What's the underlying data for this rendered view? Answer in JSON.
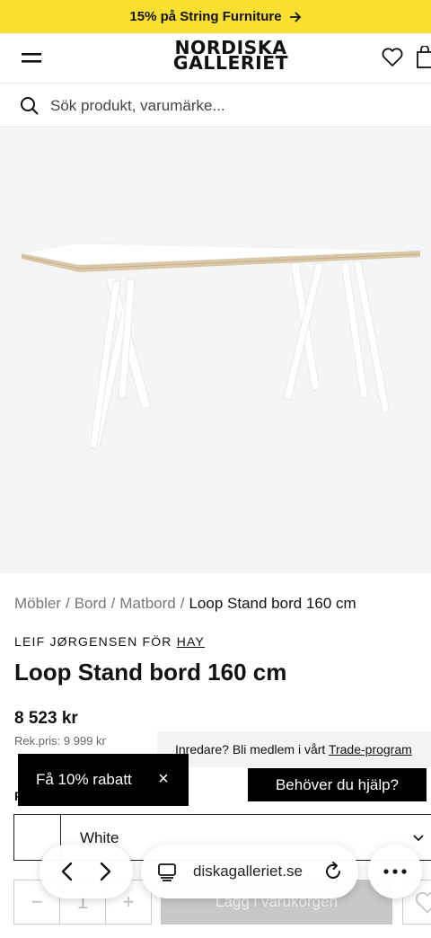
{
  "promo": {
    "text": "15% på String Furniture"
  },
  "header": {
    "logo_line1": "NORDISKA",
    "logo_line2": "GALLERIET"
  },
  "search": {
    "placeholder": "Sök produkt, varumärke..."
  },
  "breadcrumb": {
    "items": [
      "Möbler",
      "Bord",
      "Matbord"
    ],
    "current": "Loop Stand bord 160 cm",
    "separator": "/"
  },
  "product": {
    "designer": "LEIF JØRGENSEN FÖR",
    "brand": "HAY",
    "title": "Loop Stand bord 160 cm",
    "price": "8 523 kr",
    "regular_price": "Rek.pris: 9 999 kr",
    "color_label": "F",
    "color_value": "White",
    "quantity": "1",
    "cart_label": "Lägg i varukorgen"
  },
  "trade_banner": {
    "text": "Inredare? Bli medlem i vårt ",
    "link": "Trade-program"
  },
  "discount_popup": {
    "text": "Få 10% rabatt",
    "close": "×"
  },
  "help_button": {
    "label": "Behöver du hjälp?"
  },
  "browser": {
    "url": "diskagalleriet.se"
  },
  "colors": {
    "promo_bg": "#f9df2f",
    "hero_bg": "#f5f5f5",
    "popup_bg": "#000000",
    "cart_disabled": "#c8c8c8"
  },
  "icons": [
    "menu-icon",
    "heart-icon",
    "bag-icon",
    "search-icon",
    "arrow-right-icon",
    "close-icon",
    "chevron-down-icon",
    "back-icon",
    "forward-icon",
    "tabs-icon",
    "reload-icon",
    "more-icon"
  ]
}
